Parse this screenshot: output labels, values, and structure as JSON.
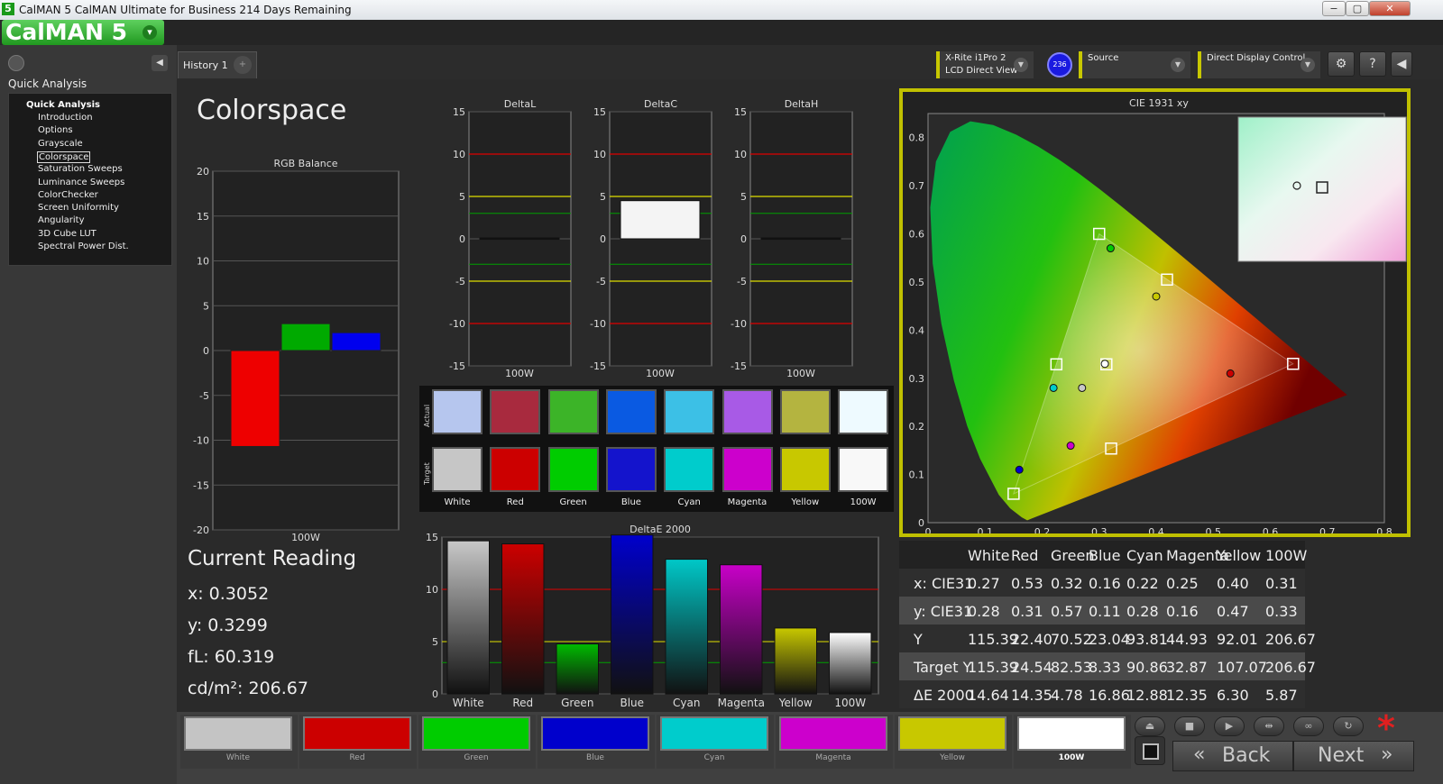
{
  "window": {
    "title": "CalMAN 5 CalMAN Ultimate for Business 214 Days Remaining",
    "app_icon": "5",
    "minimize": "−",
    "maximize": "▢",
    "close": "✕"
  },
  "logo": {
    "text": "CalMAN 5",
    "dropdown": "▾"
  },
  "sidebar": {
    "section": "Quick Analysis",
    "tree_root": "Quick Analysis",
    "items": [
      "Introduction",
      "Options",
      "Grayscale",
      "Colorspace",
      "Saturation Sweeps",
      "Luminance Sweeps",
      "ColorChecker",
      "Screen Uniformity",
      "Angularity",
      "3D Cube LUT",
      "Spectral Power Dist."
    ],
    "selected": "Colorspace"
  },
  "tabs": {
    "history": "History 1",
    "add": "+"
  },
  "devices": {
    "meter_line1": "X-Rite i1Pro 2",
    "meter_line2": "LCD Direct View",
    "meter_badge": "236",
    "source": "Source",
    "display": "Direct Display Control"
  },
  "toolbar": {
    "settings_icon": "⚙",
    "help_icon": "?",
    "collapse_icon": "◀"
  },
  "page": {
    "title": "Colorspace"
  },
  "current_reading": {
    "title": "Current Reading",
    "x": "x: 0.3052",
    "y": "y: 0.3299",
    "fl": "fL: 60.319",
    "cdm2": "cd/m²: 206.67"
  },
  "swatches": {
    "actual_label": "Actual",
    "target_label": "Target",
    "items": [
      {
        "name": "White",
        "actual": "#b6c6ee",
        "target": "#c6c6c6"
      },
      {
        "name": "Red",
        "actual": "#a82a3e",
        "target": "#cc0000"
      },
      {
        "name": "Green",
        "actual": "#3cb428",
        "target": "#00cc00"
      },
      {
        "name": "Blue",
        "actual": "#0a5ae2",
        "target": "#1414cc"
      },
      {
        "name": "Cyan",
        "actual": "#3cc0e6",
        "target": "#00cccc"
      },
      {
        "name": "Magenta",
        "actual": "#a85ae6",
        "target": "#cc00cc"
      },
      {
        "name": "Yellow",
        "actual": "#b4b440",
        "target": "#c8c800"
      },
      {
        "name": "100W",
        "actual": "#eefaff",
        "target": "#f8f8f8"
      }
    ]
  },
  "results_table": {
    "headers": [
      "",
      "White",
      "Red",
      "Green",
      "Blue",
      "Cyan",
      "Magenta",
      "Yellow",
      "100W"
    ],
    "rows": [
      [
        "x: CIE31",
        "0.27",
        "0.53",
        "0.32",
        "0.16",
        "0.22",
        "0.25",
        "0.40",
        "0.31"
      ],
      [
        "y: CIE31",
        "0.28",
        "0.31",
        "0.57",
        "0.11",
        "0.28",
        "0.16",
        "0.47",
        "0.33"
      ],
      [
        "Y",
        "115.39",
        "22.40",
        "70.52",
        "23.04",
        "93.81",
        "44.93",
        "92.01",
        "206.67"
      ],
      [
        "Target Y",
        "115.39",
        "24.54",
        "82.53",
        "8.33",
        "90.86",
        "32.87",
        "107.07",
        "206.67"
      ],
      [
        "ΔE 2000",
        "14.64",
        "14.35",
        "4.78",
        "16.86",
        "12.88",
        "12.35",
        "6.30",
        "5.87"
      ]
    ]
  },
  "bottom_swatches": [
    {
      "name": "White",
      "color": "#c4c4c4"
    },
    {
      "name": "Red",
      "color": "#cc0000"
    },
    {
      "name": "Green",
      "color": "#00cc00"
    },
    {
      "name": "Blue",
      "color": "#0000cc"
    },
    {
      "name": "Cyan",
      "color": "#00cccc"
    },
    {
      "name": "Magenta",
      "color": "#cc00cc"
    },
    {
      "name": "Yellow",
      "color": "#c8c800"
    },
    {
      "name": "100W",
      "color": "#ffffff"
    }
  ],
  "controls": {
    "icons": [
      "eject-icon",
      "stop-icon",
      "play-icon",
      "range-icon",
      "loop-icon",
      "refresh-icon"
    ],
    "glyphs": [
      "⏏",
      "■",
      "▶",
      "⇹",
      "∞",
      "↻"
    ],
    "back": "Back",
    "next": "Next",
    "back_arrow": "«",
    "next_arrow": "»",
    "asterisk": "*"
  },
  "chart_data": [
    {
      "type": "bar",
      "title": "RGB Balance",
      "categories": [
        "100W"
      ],
      "series": [
        {
          "name": "Red",
          "values": [
            -10.7
          ],
          "color": "#ee0000"
        },
        {
          "name": "Green",
          "values": [
            3.0
          ],
          "color": "#00aa00"
        },
        {
          "name": "Blue",
          "values": [
            2.0
          ],
          "color": "#0000ee"
        }
      ],
      "ylim": [
        -20,
        20
      ],
      "yticks": [
        20,
        15,
        10,
        5,
        0,
        -5,
        -10,
        -15,
        -20
      ]
    },
    {
      "type": "bar",
      "title": "DeltaL",
      "categories": [
        "100W"
      ],
      "values": [
        0.1
      ],
      "ylim": [
        -15,
        15
      ],
      "yticks": [
        15,
        10,
        5,
        0,
        -5,
        -10,
        -15
      ],
      "red_lines": [
        10,
        -10
      ],
      "yellow_lines": [
        5,
        -5
      ],
      "green_lines": [
        3,
        -3
      ]
    },
    {
      "type": "bar",
      "title": "DeltaC",
      "categories": [
        "100W"
      ],
      "values": [
        4.5
      ],
      "ylim": [
        -15,
        15
      ],
      "yticks": [
        15,
        10,
        5,
        0,
        -5,
        -10,
        -15
      ],
      "red_lines": [
        10,
        -10
      ],
      "yellow_lines": [
        5,
        -5
      ],
      "green_lines": [
        3,
        -3
      ]
    },
    {
      "type": "bar",
      "title": "DeltaH",
      "categories": [
        "100W"
      ],
      "values": [
        0.1
      ],
      "ylim": [
        -15,
        15
      ],
      "yticks": [
        15,
        10,
        5,
        0,
        -5,
        -10,
        -15
      ],
      "red_lines": [
        10,
        -10
      ],
      "yellow_lines": [
        5,
        -5
      ],
      "green_lines": [
        3,
        -3
      ]
    },
    {
      "type": "bar",
      "title": "DeltaE 2000",
      "categories": [
        "White",
        "Red",
        "Green",
        "Blue",
        "Cyan",
        "Magenta",
        "Yellow",
        "100W"
      ],
      "values": [
        14.64,
        14.35,
        4.78,
        16.86,
        12.88,
        12.35,
        6.3,
        5.87
      ],
      "colors": [
        "#c8c8c8",
        "#cc0000",
        "#00bb00",
        "#0000cc",
        "#00c8c8",
        "#c800c8",
        "#c8c800",
        "#ffffff"
      ],
      "ylim": [
        0,
        15
      ],
      "yticks": [
        15,
        10,
        5,
        0
      ],
      "red_line": 10,
      "yellow_line": 5,
      "green_line": 3
    },
    {
      "type": "scatter",
      "title": "CIE 1931 xy",
      "xlim": [
        0,
        0.8
      ],
      "ylim": [
        0,
        0.85
      ],
      "xticks": [
        0,
        0.1,
        0.2,
        0.3,
        0.4,
        0.5,
        0.6,
        0.7,
        0.8
      ],
      "yticks": [
        0,
        0.1,
        0.2,
        0.3,
        0.4,
        0.5,
        0.6,
        0.7,
        0.8
      ],
      "targets": [
        {
          "name": "Red",
          "x": 0.64,
          "y": 0.33
        },
        {
          "name": "Green",
          "x": 0.3,
          "y": 0.6
        },
        {
          "name": "Blue",
          "x": 0.15,
          "y": 0.06
        },
        {
          "name": "Cyan",
          "x": 0.225,
          "y": 0.329
        },
        {
          "name": "Magenta",
          "x": 0.321,
          "y": 0.154
        },
        {
          "name": "Yellow",
          "x": 0.419,
          "y": 0.505
        },
        {
          "name": "White",
          "x": 0.3127,
          "y": 0.329
        }
      ],
      "measured": [
        {
          "name": "White",
          "x": 0.27,
          "y": 0.28,
          "color": "#c8c8c8"
        },
        {
          "name": "Red",
          "x": 0.53,
          "y": 0.31,
          "color": "#cc0000"
        },
        {
          "name": "Green",
          "x": 0.32,
          "y": 0.57,
          "color": "#00cc00"
        },
        {
          "name": "Blue",
          "x": 0.16,
          "y": 0.11,
          "color": "#0000cc"
        },
        {
          "name": "Cyan",
          "x": 0.22,
          "y": 0.28,
          "color": "#00cccc"
        },
        {
          "name": "Magenta",
          "x": 0.25,
          "y": 0.16,
          "color": "#cc00cc"
        },
        {
          "name": "Yellow",
          "x": 0.4,
          "y": 0.47,
          "color": "#c8c800"
        },
        {
          "name": "100W",
          "x": 0.31,
          "y": 0.33,
          "color": "#ffffff"
        }
      ]
    }
  ]
}
